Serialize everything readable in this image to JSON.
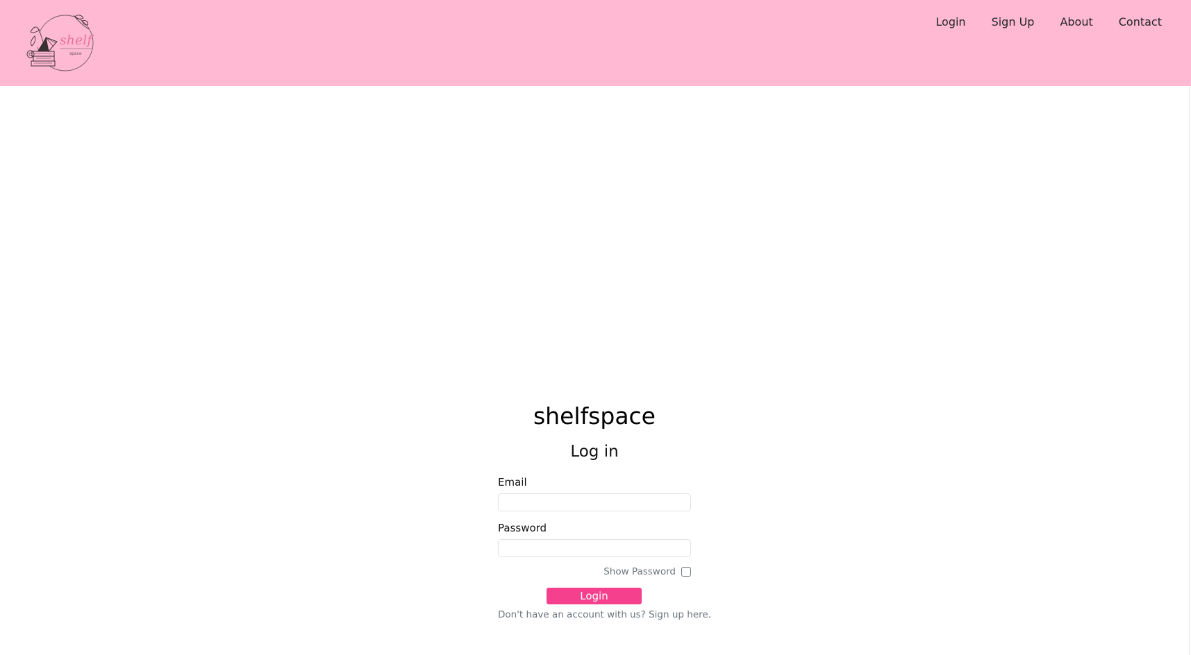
{
  "header": {
    "logo": {
      "name": "shelfspace-logo",
      "wordmark": "shelf",
      "sub": "space"
    },
    "nav": [
      {
        "label": "Login"
      },
      {
        "label": "Sign Up"
      },
      {
        "label": "About"
      },
      {
        "label": "Contact"
      }
    ]
  },
  "form": {
    "brand": "shelfspace",
    "title": "Log in",
    "email_label": "Email",
    "email_value": "",
    "password_label": "Password",
    "password_value": "",
    "show_password_label": "Show Password",
    "show_password_checked": false,
    "submit_label": "Login",
    "signup_prompt": "Don't have an account with us?",
    "signup_link": "Sign up here."
  },
  "colors": {
    "header_bg": "#ffb9d2",
    "accent": "#f5418d",
    "page_bg": "#ffffff"
  }
}
